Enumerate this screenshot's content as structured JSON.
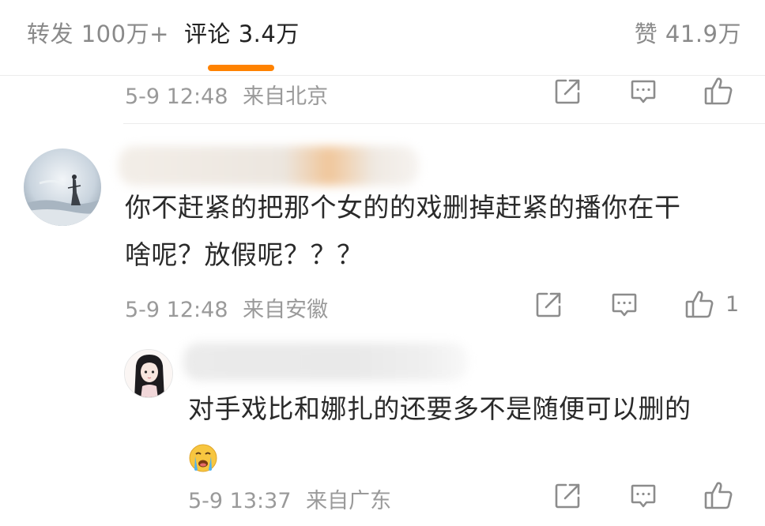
{
  "tabs": {
    "repost": "转发 100万+",
    "comments": "评论 3.4万",
    "likes": "赞 41.9万"
  },
  "top_comment": {
    "time": "5-9 12:48",
    "location": "来自北京"
  },
  "comment": {
    "text_line1": "你不赶紧的把那个女的的戏删掉赶紧的播你在干",
    "text_line2": "啥呢？放假呢？？？",
    "time": "5-9 12:48",
    "location": "来自安徽",
    "like_count": "1"
  },
  "reply": {
    "text": "对手戏比和娜扎的还要多不是随便可以删的",
    "emoji": "crying-face-emoji",
    "time": "5-9 13:37",
    "location": "来自广东"
  },
  "colors": {
    "accent": "#ff8200",
    "meta_gray": "#9a9a9a",
    "icon_gray": "#8c8c8c"
  }
}
